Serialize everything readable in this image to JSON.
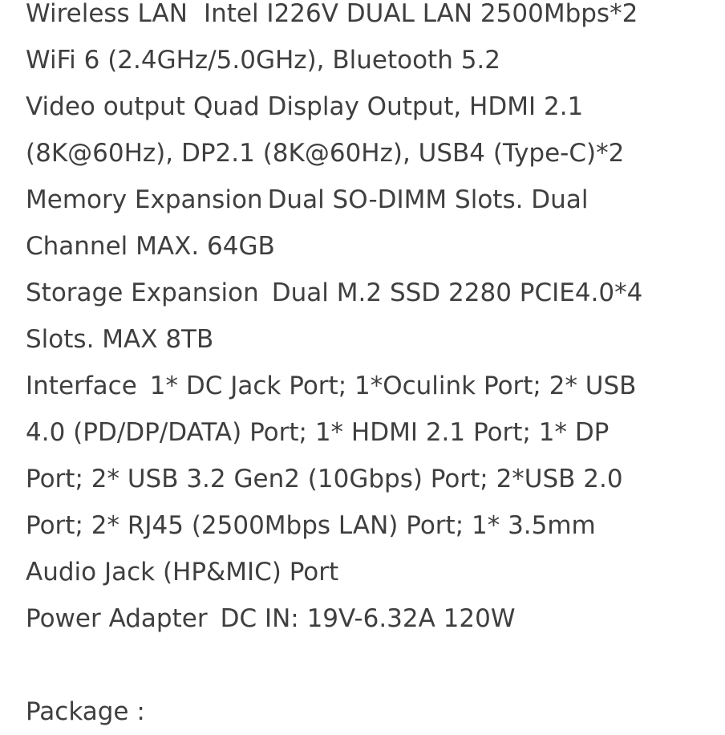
{
  "colors": {
    "background": "#ffffff",
    "text": "#3f3f3f"
  },
  "specs": {
    "wireless": {
      "label": "Wireless LAN",
      "value_line1": "Intel I226V DUAL LAN 2500Mbps*2",
      "value_line2": "WiFi 6 (2.4GHz/5.0GHz), Bluetooth 5.2"
    },
    "video": {
      "label": "Video output",
      "value_line1": "Quad Display Output, HDMI 2.1",
      "value_line2": "(8K@60Hz), DP2.1 (8K@60Hz), USB4 (Type-C)*2"
    },
    "memory": {
      "label": "Memory Expansion",
      "value_line1": "Dual SO-DIMM Slots. Dual",
      "value_line2": "Channel MAX. 64GB"
    },
    "storage": {
      "label": "Storage Expansion",
      "value_line1": "Dual M.2 SSD 2280 PCIE4.0*4",
      "value_line2": "Slots. MAX 8TB"
    },
    "interface": {
      "label": "Interface",
      "value_line1": "1* DC Jack Port; 1*Oculink Port; 2* USB",
      "value_line2": "4.0 (PD/DP/DATA) Port; 1* HDMI 2.1 Port; 1* DP",
      "value_line3": "Port; 2* USB 3.2 Gen2 (10Gbps) Port; 2*USB 2.0",
      "value_line4": "Port; 2* RJ45 (2500Mbps LAN) Port; 1* 3.5mm",
      "value_line5": "Audio Jack (HP&MIC) Port"
    },
    "power": {
      "label": "Power Adapter",
      "value": "DC IN: 19V-6.32A 120W"
    }
  },
  "package_heading": "Package :"
}
